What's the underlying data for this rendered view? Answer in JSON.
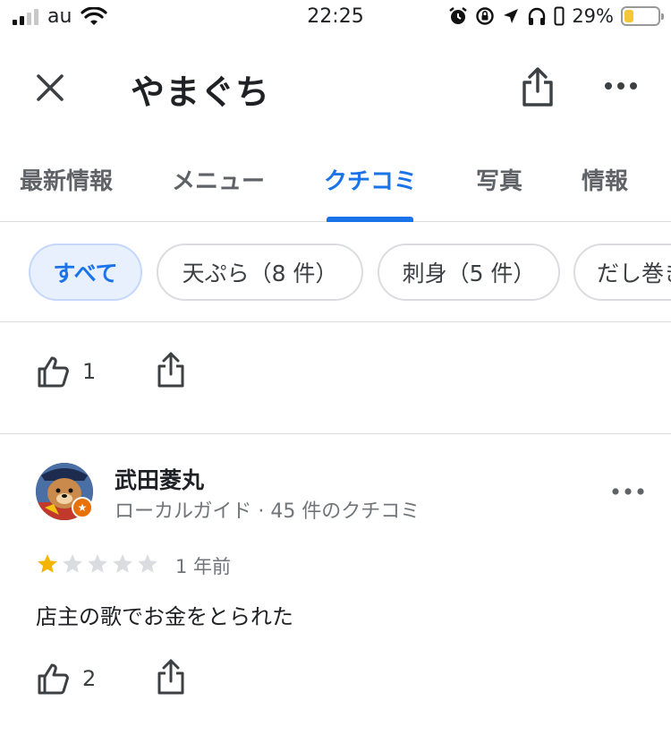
{
  "status_bar": {
    "carrier": "au",
    "time": "22:25",
    "battery_percent": "29%",
    "battery_level": 0.29,
    "icons": [
      "signal-icon",
      "wifi-icon",
      "alarm-icon",
      "rotation-lock-icon",
      "location-icon",
      "headphones-icon",
      "battery-icon"
    ]
  },
  "header": {
    "title": "やまぐち",
    "icons": [
      "close-icon",
      "share-icon",
      "more-vert-icon"
    ]
  },
  "tabs": [
    {
      "label": "最新情報",
      "active": false
    },
    {
      "label": "メニュー",
      "active": false
    },
    {
      "label": "クチコミ",
      "active": true
    },
    {
      "label": "写真",
      "active": false
    },
    {
      "label": "情報",
      "active": false
    }
  ],
  "chips": [
    {
      "label": "すべて",
      "active": true
    },
    {
      "label": "天ぷら（8 件）",
      "active": false
    },
    {
      "label": "刺身（5 件）",
      "active": false
    },
    {
      "label": "だし巻き",
      "active": false
    }
  ],
  "previous_review": {
    "like_count": "1"
  },
  "review": {
    "reviewer_name": "武田菱丸",
    "reviewer_meta": "ローカルガイド · 45 件のクチコミ",
    "rating": 1,
    "rating_max": 5,
    "date": "1 年前",
    "text": "店主の歌でお金をとられた",
    "like_count": "2"
  },
  "colors": {
    "accent": "#1a73e8",
    "chip_active_bg": "#e8f0fe",
    "star_filled": "#f5b400",
    "star_empty": "#dadce0",
    "battery_fill": "#f6c634",
    "badge": "#e8710a"
  }
}
